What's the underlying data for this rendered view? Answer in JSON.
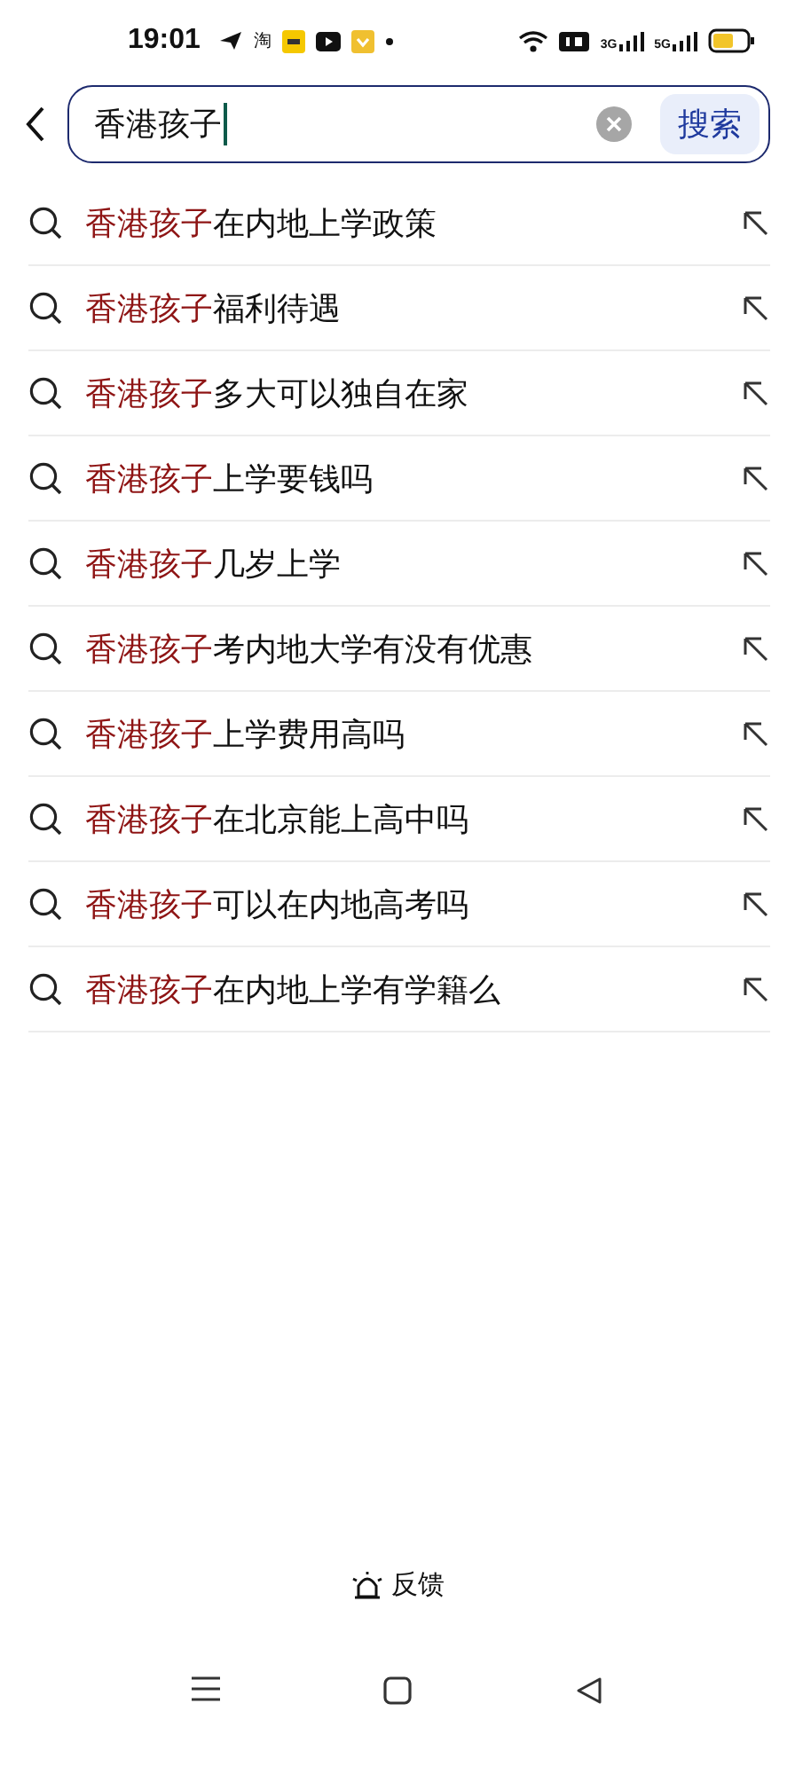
{
  "status_bar": {
    "time": "19:01",
    "app_glyph": "淘",
    "network_1": "3G",
    "network_2": "5G"
  },
  "search": {
    "value": "香港孩子",
    "button": "搜索"
  },
  "suggestions": [
    {
      "highlight": "香港孩子",
      "rest": "在内地上学政策"
    },
    {
      "highlight": "香港孩子",
      "rest": "福利待遇"
    },
    {
      "highlight": "香港孩子",
      "rest": "多大可以独自在家"
    },
    {
      "highlight": "香港孩子",
      "rest": "上学要钱吗"
    },
    {
      "highlight": "香港孩子",
      "rest": "几岁上学"
    },
    {
      "highlight": "香港孩子",
      "rest": "考内地大学有没有优惠"
    },
    {
      "highlight": "香港孩子",
      "rest": "上学费用高吗"
    },
    {
      "highlight": "香港孩子",
      "rest": "在北京能上高中吗"
    },
    {
      "highlight": "香港孩子",
      "rest": "可以在内地高考吗"
    },
    {
      "highlight": "香港孩子",
      "rest": "在内地上学有学籍么"
    }
  ],
  "feedback": "反馈"
}
